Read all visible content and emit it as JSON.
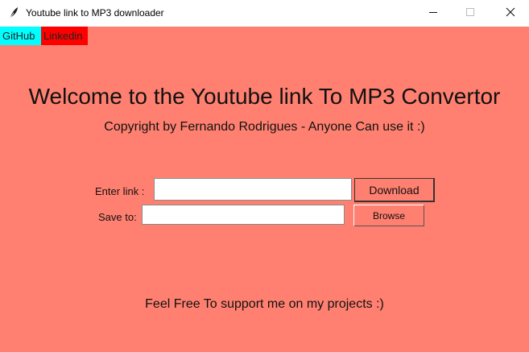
{
  "window": {
    "title": "Youtube link to MP3 downloader",
    "app_icon": "feather-icon",
    "controls": [
      "minimize-icon",
      "maximize-icon",
      "close-icon"
    ]
  },
  "links": {
    "github": "GitHub",
    "linkedin": "Linkedin"
  },
  "main": {
    "heading": "Welcome to the Youtube link To MP3 Convertor",
    "copyright": "Copyright by Fernando Rodrigues - Anyone Can use it :)"
  },
  "form": {
    "link_label": "Enter link :",
    "link_value": "",
    "download_label": "Download",
    "save_label": "Save to:",
    "save_value": "",
    "browse_label": "Browse"
  },
  "footer": {
    "support": "Feel Free To support me on my projects :)"
  },
  "colors": {
    "background": "#ff8070",
    "github": "#00ffff",
    "linkedin": "#ff0000",
    "titlebar": "#ffffff"
  }
}
